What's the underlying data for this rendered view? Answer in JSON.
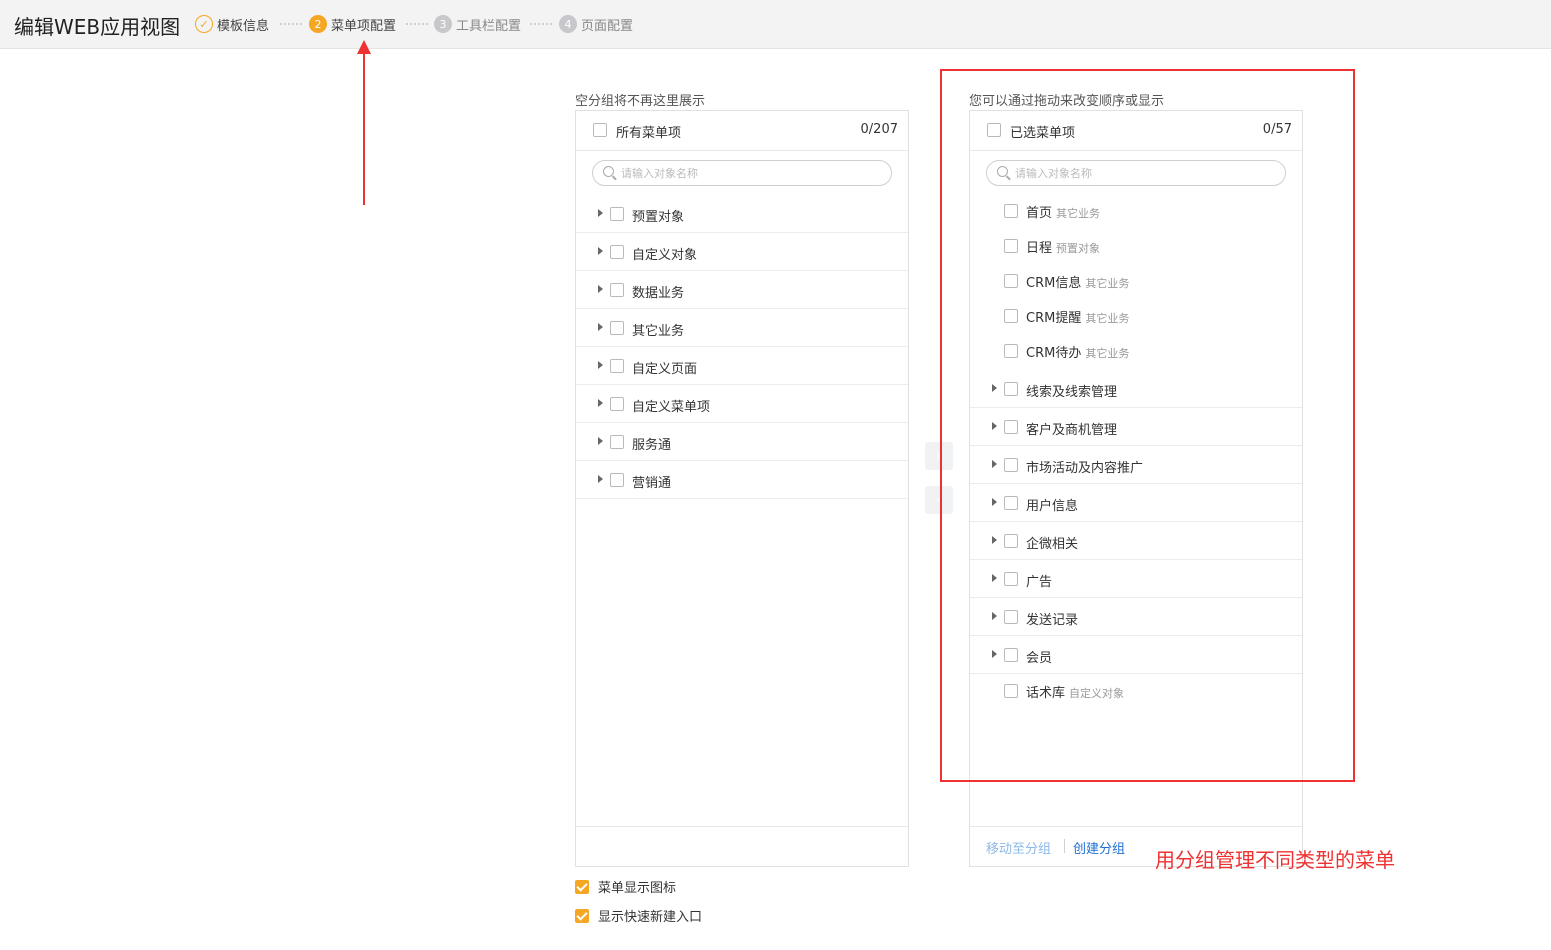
{
  "header": {
    "title": "编辑WEB应用视图",
    "steps": [
      {
        "num": "✓",
        "label": "模板信息",
        "state": "done"
      },
      {
        "num": "2",
        "label": "菜单项配置",
        "state": "active"
      },
      {
        "num": "3",
        "label": "工具栏配置",
        "state": "todo"
      },
      {
        "num": "4",
        "label": "页面配置",
        "state": "todo"
      }
    ]
  },
  "left": {
    "hint": "空分组将不再这里展示",
    "header_label": "所有菜单项",
    "count": "0/207",
    "search_placeholder": "请输入对象名称",
    "items": [
      {
        "label": "预置对象"
      },
      {
        "label": "自定义对象"
      },
      {
        "label": "数据业务"
      },
      {
        "label": "其它业务"
      },
      {
        "label": "自定义页面"
      },
      {
        "label": "自定义菜单项"
      },
      {
        "label": "服务通"
      },
      {
        "label": "营销通"
      }
    ]
  },
  "right": {
    "hint": "您可以通过拖动来改变顺序或显示",
    "header_label": "已选菜单项",
    "count": "0/57",
    "search_placeholder": "请输入对象名称",
    "items": [
      {
        "label": "首页",
        "sub": "其它业务"
      },
      {
        "label": "日程",
        "sub": "预置对象"
      },
      {
        "label": "CRM信息",
        "sub": "其它业务"
      },
      {
        "label": "CRM提醒",
        "sub": "其它业务"
      },
      {
        "label": "CRM待办",
        "sub": "其它业务"
      },
      {
        "label": "线索及线索管理"
      },
      {
        "label": "客户及商机管理"
      },
      {
        "label": "市场活动及内容推广"
      },
      {
        "label": "用户信息"
      },
      {
        "label": "企微相关"
      },
      {
        "label": "广告"
      },
      {
        "label": "发送记录"
      },
      {
        "label": "会员"
      },
      {
        "label": "话术库",
        "sub": "自定义对象"
      }
    ],
    "footer": {
      "move_label": "移动至分组",
      "create_label": "创建分组"
    }
  },
  "transfer": {
    "right_glyph": "›",
    "left_glyph": "‹"
  },
  "options": [
    {
      "label": "菜单显示图标",
      "checked": true
    },
    {
      "label": "显示快速新建入口",
      "checked": true
    }
  ],
  "annotation": {
    "note": "用分组管理不同类型的菜单",
    "color": "#ee3131"
  },
  "colors": {
    "accent": "#f5a623",
    "link": "#1f6fd6",
    "link_muted": "#8cb8e8"
  }
}
